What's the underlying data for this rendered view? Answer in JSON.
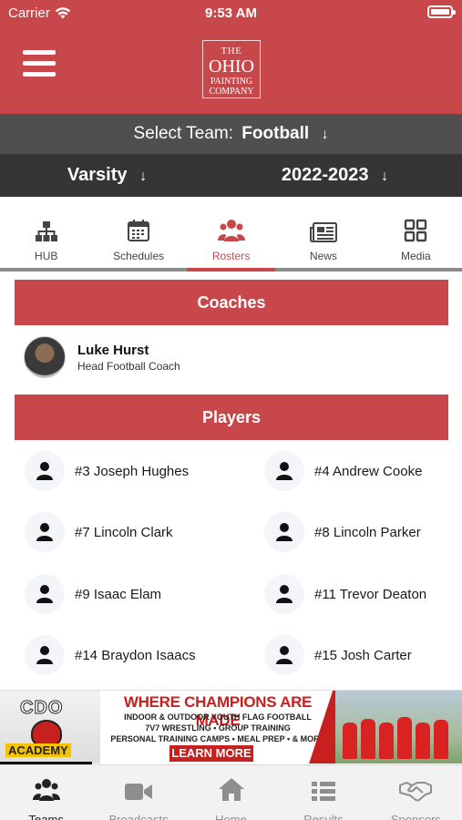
{
  "status_bar": {
    "carrier": "Carrier",
    "time": "9:53 AM"
  },
  "header": {
    "logo": {
      "line1": "THE",
      "line2": "OHIO",
      "line3": "PAINTING",
      "line4": "COMPANY"
    }
  },
  "team_selector": {
    "label": "Select Team:",
    "value": "Football",
    "arrow": "↓"
  },
  "level_selector": {
    "value": "Varsity",
    "arrow": "↓"
  },
  "season_selector": {
    "value": "2022-2023",
    "arrow": "↓"
  },
  "tabs": [
    {
      "label": "HUB",
      "icon": "hierarchy-icon"
    },
    {
      "label": "Schedules",
      "icon": "calendar-icon"
    },
    {
      "label": "Rosters",
      "icon": "users-icon",
      "active": true
    },
    {
      "label": "News",
      "icon": "newspaper-icon"
    },
    {
      "label": "Media",
      "icon": "grid-icon"
    }
  ],
  "coaches": {
    "header": "Coaches",
    "items": [
      {
        "name": "Luke Hurst",
        "role": "Head Football Coach"
      }
    ]
  },
  "players": {
    "header": "Players",
    "items": [
      {
        "label": "#3 Joseph Hughes"
      },
      {
        "label": "#4 Andrew Cooke"
      },
      {
        "label": "#7 Lincoln Clark"
      },
      {
        "label": "#8 Lincoln Parker"
      },
      {
        "label": "#9 Isaac Elam"
      },
      {
        "label": "#11 Trevor Deaton"
      },
      {
        "label": "#14 Braydon Isaacs"
      },
      {
        "label": "#15 Josh Carter"
      }
    ]
  },
  "ad": {
    "brand": "CDO",
    "brand_sub": "ACADEMY",
    "headline": "WHERE CHAMPIONS ARE MADE",
    "line1": "INDOOR & OUTDOOR YOUTH FLAG FOOTBALL",
    "line2": "7V7 WRESTLING • GROUP TRAINING",
    "line3": "PERSONAL TRAINING CAMPS • MEAL PREP • & MORE",
    "cta": "LEARN MORE"
  },
  "bottom_nav": [
    {
      "label": "Teams",
      "icon": "users-icon",
      "active": true
    },
    {
      "label": "Broadcasts",
      "icon": "video-camera-icon"
    },
    {
      "label": "Home",
      "icon": "home-icon"
    },
    {
      "label": "Results",
      "icon": "list-icon"
    },
    {
      "label": "Sponsors",
      "icon": "handshake-icon"
    }
  ],
  "colors": {
    "brand_red": "#c8474a",
    "dark_gray": "#353535",
    "mid_gray": "#4f4f4f"
  }
}
